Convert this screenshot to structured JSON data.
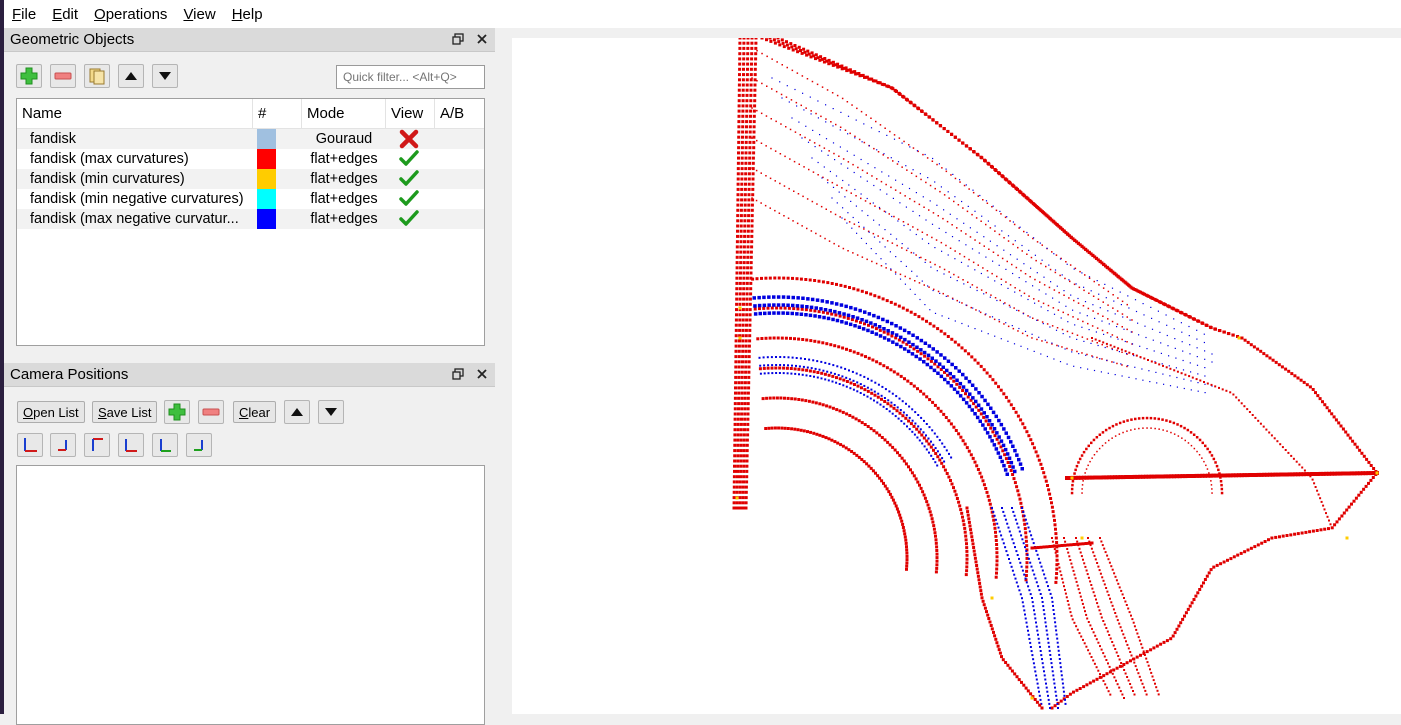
{
  "menu": {
    "file": {
      "u": "F",
      "rest": "ile"
    },
    "edit": {
      "u": "E",
      "rest": "dit"
    },
    "operations": {
      "u": "O",
      "rest": "perations"
    },
    "view": {
      "u": "V",
      "rest": "iew"
    },
    "help": {
      "u": "H",
      "rest": "elp"
    }
  },
  "geometric_panel": {
    "title": "Geometric Objects",
    "filter_placeholder": "Quick filter... <Alt+Q>",
    "columns": [
      "Name",
      "#",
      "Mode",
      "View",
      "A/B"
    ],
    "rows": [
      {
        "name": "fandisk",
        "color": "#a0c0e0",
        "mode": "Gouraud",
        "visible": false
      },
      {
        "name": "fandisk (max curvatures)",
        "color": "#ff0000",
        "mode": "flat+edges",
        "visible": true
      },
      {
        "name": "fandisk (min curvatures)",
        "color": "#ffcc00",
        "mode": "flat+edges",
        "visible": true
      },
      {
        "name": "fandisk (min negative curvatures)",
        "color": "#00ffff",
        "mode": "flat+edges",
        "visible": true
      },
      {
        "name": "fandisk (max negative curvatur...",
        "color": "#0000ff",
        "mode": "flat+edges",
        "visible": true
      }
    ]
  },
  "camera_panel": {
    "title": "Camera Positions",
    "open_list": {
      "u": "O",
      "rest": "pen List"
    },
    "save_list": {
      "u": "S",
      "rest": "ave List"
    },
    "clear": {
      "u": "C",
      "rest": "lear"
    }
  },
  "icons": {
    "restore": "restore-icon",
    "close": "close-icon",
    "add": "plus-icon",
    "remove": "minus-icon",
    "duplicate": "duplicate-icon",
    "up": "arrow-up-icon",
    "down": "arrow-down-icon",
    "visible": "checkmark-icon",
    "hidden": "x-mark-icon"
  },
  "colors": {
    "max_curvature": "#e00000",
    "max_negative_curvature": "#0000e0",
    "min_curvature": "#ffcc00"
  }
}
